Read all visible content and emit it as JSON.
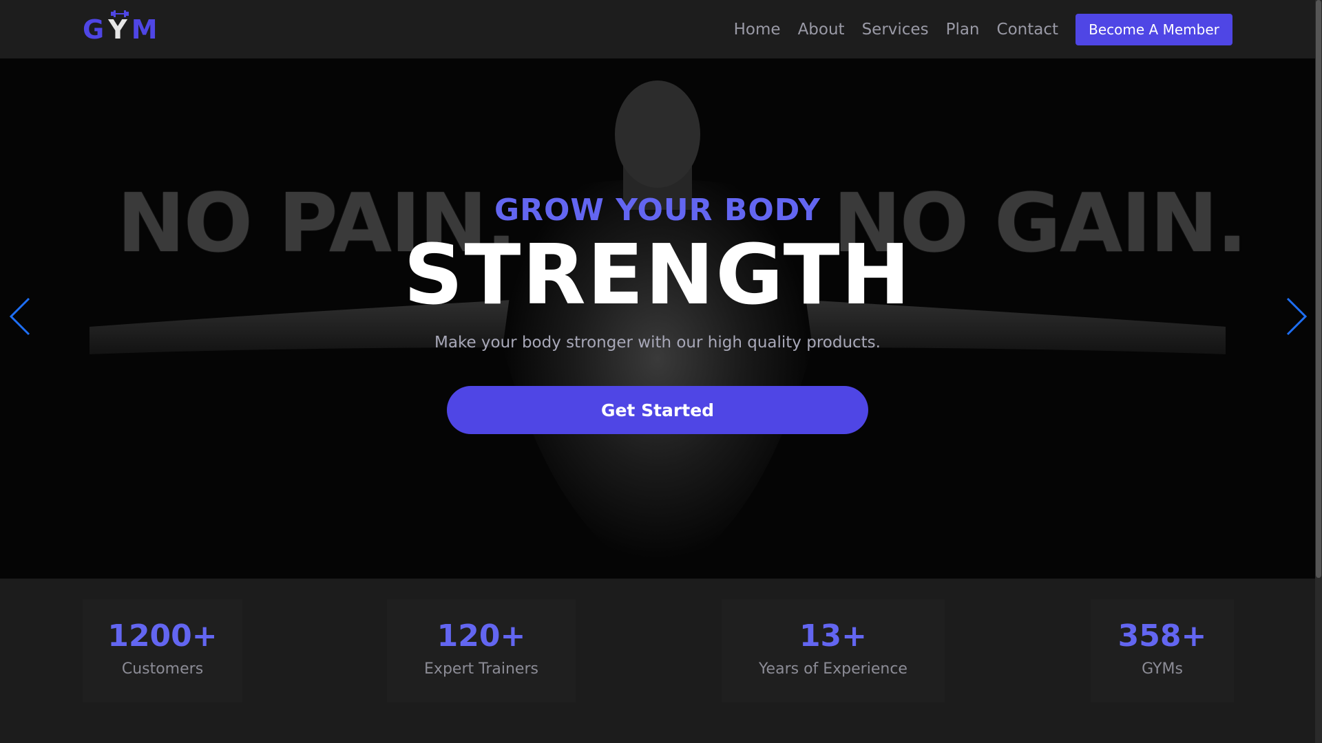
{
  "logo": {
    "left": "G",
    "middle": "Y",
    "right": "M"
  },
  "nav": {
    "links": [
      "Home",
      "About",
      "Services",
      "Plan",
      "Contact"
    ],
    "cta": "Become A Member"
  },
  "hero": {
    "background_text_left": "NO PAIN.",
    "background_text_right": "NO GAIN.",
    "subtitle": "GROW YOUR BODY",
    "title": "STRENGTH",
    "description": "Make your body stronger with our high quality products.",
    "cta": "Get Started",
    "prev_icon": "chevron-left-icon",
    "next_icon": "chevron-right-icon"
  },
  "stats": [
    {
      "value": "1200+",
      "label": "Customers"
    },
    {
      "value": "120+",
      "label": "Expert Trainers"
    },
    {
      "value": "13+",
      "label": "Years of Experience"
    },
    {
      "value": "358+",
      "label": "GYMs"
    }
  ],
  "colors": {
    "accent": "#4f46e5",
    "accent_light": "#6366f1",
    "background": "#1c1c1c",
    "hero_background": "#050505"
  }
}
